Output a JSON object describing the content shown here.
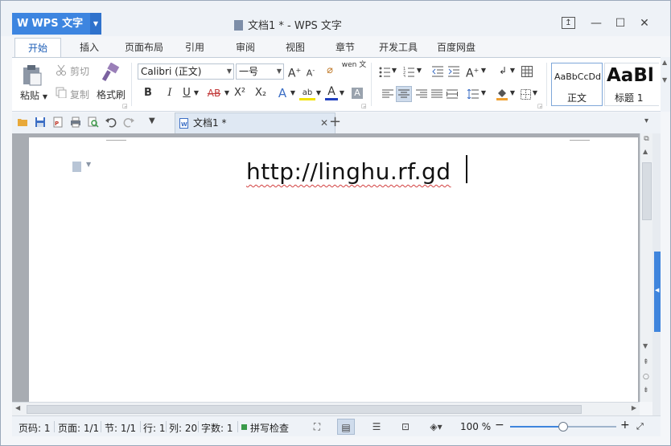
{
  "app": {
    "button_label": "WPS 文字",
    "window_title": "文档1 * - WPS 文字"
  },
  "tabs": [
    "开始",
    "插入",
    "页面布局",
    "引用",
    "审阅",
    "视图",
    "章节",
    "开发工具",
    "百度网盘"
  ],
  "ribbon": {
    "paste_label": "粘贴",
    "cut_label": "剪切",
    "copy_label": "复制",
    "format_painter_label": "格式刷",
    "font_name": "Calibri (正文)",
    "font_size": "一号",
    "bold": "B",
    "italic": "I",
    "underline": "U",
    "strikethrough": "AB",
    "superscript": "X²",
    "subscript": "X₂",
    "style_normal_preview": "AaBbCcDd",
    "style_normal_label": "正文",
    "style_heading_preview": "AaBl",
    "style_heading_label": "标题 1",
    "pinyin": "wen 文"
  },
  "quick_access": {
    "doc_tab_label": "文档1 *"
  },
  "document": {
    "text": "http://linghu.rf.gd"
  },
  "status_bar": {
    "page_number": "页码: 1",
    "page_count": "页面: 1/1",
    "section": "节: 1/1",
    "row": "行: 1",
    "column": "列: 20",
    "word_count": "字数: 1",
    "spell_check": "拼写检查",
    "zoom": "100 %",
    "zoom_level": 0.5
  },
  "colors": {
    "accent": "#3d85e0",
    "font_color": "#1f3fbf",
    "highlight": "#f2e100",
    "spell_underline": "#d24040"
  }
}
